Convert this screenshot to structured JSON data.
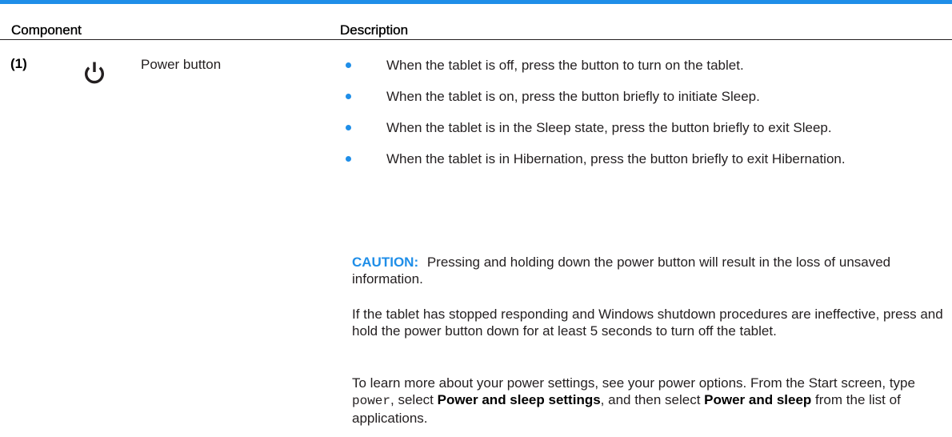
{
  "table": {
    "headers": {
      "component": "Component",
      "description": "Description"
    },
    "accent_color": "#1f8ee8",
    "row": {
      "number": "(1)",
      "icon": "power-icon",
      "name": "Power button",
      "bullets": [
        "When the tablet is off, press the button to turn on the tablet.",
        "When the tablet is on, press the button briefly to initiate Sleep.",
        "When the tablet is in the Sleep state, press the button briefly to exit Sleep.",
        "When the tablet is in Hibernation, press the button briefly to exit Hibernation."
      ],
      "caution": {
        "label": "CAUTION:",
        "text": "Pressing and holding down the power button will result in the loss of unsaved information."
      },
      "paragraph_1": "If the tablet has stopped responding and Windows shutdown procedures are ineffective, press and hold the power button down for at least 5 seconds to turn off the tablet.",
      "paragraph_2": {
        "part_1": "To learn more about your power settings, see your power options. From the Start screen, type ",
        "code": "power",
        "part_2": ", select ",
        "bold_1": "Power and sleep settings",
        "part_3": ", and then select ",
        "bold_2": "Power and sleep",
        "part_4": " from the list of applications."
      }
    }
  }
}
